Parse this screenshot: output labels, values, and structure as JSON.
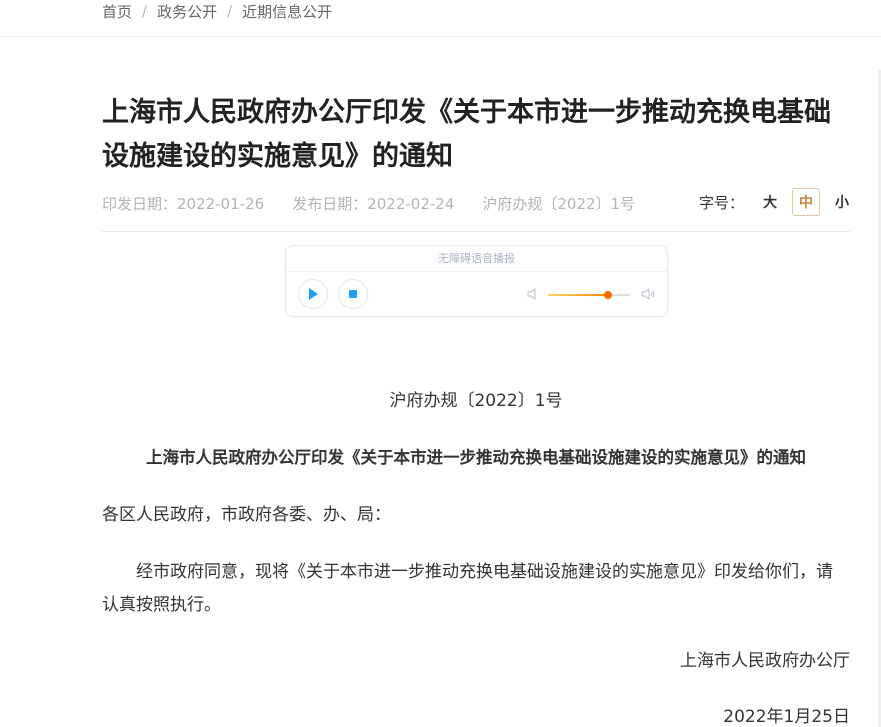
{
  "breadcrumb": [
    "首页",
    "政务公开",
    "近期信息公开"
  ],
  "breadcrumb_separator": "/",
  "article": {
    "title": "上海市人民政府办公厅印发《关于本市进一步推动充换电基础设施建设的实施意见》的通知",
    "print_date": "印发日期：2022-01-26",
    "publish_date": "发布日期：2022-02-24",
    "doc_number": "沪府办规〔2022〕1号"
  },
  "font_size": {
    "label": "字号：",
    "options": [
      "大",
      "中",
      "小"
    ],
    "selected": "中"
  },
  "player": {
    "title": "无障碍语音播报",
    "volume_fraction": 0.73,
    "icons": [
      "play-icon",
      "stop-icon",
      "volume-low-icon",
      "volume-high-icon"
    ],
    "accent": "#1aa0ff",
    "volume_color": "#ff8a00"
  },
  "body": {
    "doc_number": "沪府办规〔2022〕1号",
    "title": "上海市人民政府办公厅印发《关于本市进一步推动充换电基础设施建设的实施意见》的通知",
    "salutation": "各区人民政府，市政府各委、办、局：",
    "paragraph": "经市政府同意，现将《关于本市进一步推动充换电基础设施建设的实施意见》印发给你们，请认真按照执行。",
    "issuer": "上海市人民政府办公厅",
    "date": "2022年1月25日"
  }
}
